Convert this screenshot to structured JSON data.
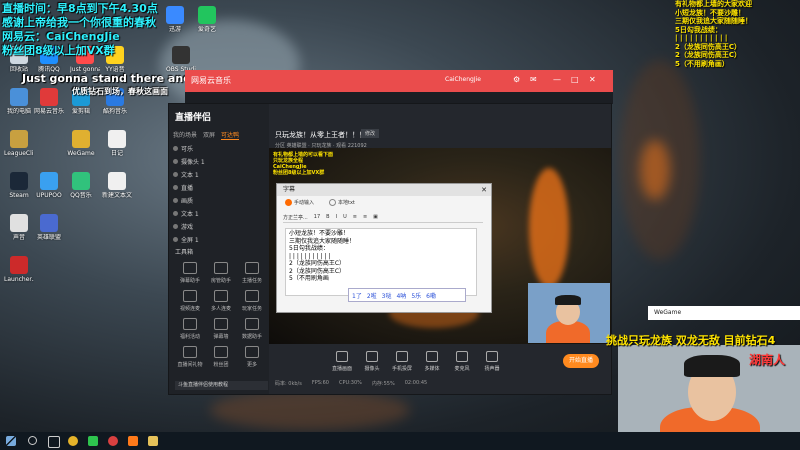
{
  "overlay_top": {
    "line1": "直播时间：早8点到下午4.30点",
    "line2": "感谢上帝给我一个你很重的春秋",
    "line3": "网易云：CaiChengJie",
    "line4": "粉丝团8级以上加VX群",
    "caption": "Just gonna stand there and hear me cry",
    "caption2": "优质钻石到场，春秋这画面"
  },
  "desktop_icons": [
    {
      "label": "回收站",
      "color": "#cfd8e0"
    },
    {
      "label": "腾讯QQ",
      "color": "#1e8fff"
    },
    {
      "label": "Just gonna",
      "color": "#ff4a4a"
    },
    {
      "label": "YY语音",
      "color": "#ffd21e"
    },
    {
      "label": "迅游",
      "color": "#3a8aff"
    },
    {
      "label": "爱奇艺",
      "color": "#22c55e"
    },
    {
      "label": "我的电脑",
      "color": "#4a90d9"
    },
    {
      "label": "网易云音乐",
      "color": "#e03a3a"
    },
    {
      "label": "爱剪辑",
      "color": "#1c9ad6"
    },
    {
      "label": "酷狗音乐",
      "color": "#2a7ae2"
    },
    {
      "label": "LeagueCli...",
      "color": "#c8a040"
    },
    {
      "label": "WeGame",
      "color": "#e0b030"
    },
    {
      "label": "日记",
      "color": "#f0f0f0"
    },
    {
      "label": "Steam",
      "color": "#1b2838"
    },
    {
      "label": "UPUPOO",
      "color": "#3aa0f0"
    },
    {
      "label": "QQ音乐",
      "color": "#31c27c"
    },
    {
      "label": "新建文本文档",
      "color": "#f0f0f0"
    },
    {
      "label": "声音",
      "color": "#e0e0e0"
    },
    {
      "label": "英雄联盟",
      "color": "#4a6ad0"
    },
    {
      "label": "Launcher...",
      "color": "#cc2a2a"
    },
    {
      "label": "OBS Studio",
      "color": "#333333"
    }
  ],
  "music_player": {
    "title": "网易云音乐",
    "user": "CaiChengJie",
    "controls": [
      "⚙",
      "✉",
      "—",
      "□",
      "✕"
    ]
  },
  "app": {
    "logo": "直播伴侣",
    "tabs": [
      "我的场景",
      "双屏",
      "可达鸭"
    ],
    "scenes": [
      "可乐",
      "摄像头 1",
      "文本 1",
      "直播",
      "画质",
      "文本 1",
      "游戏",
      "全屏 1"
    ],
    "tools_title": "工具箱",
    "tools": [
      {
        "label": "弹幕助手"
      },
      {
        "label": "房管助手"
      },
      {
        "label": "主播任务"
      },
      {
        "label": "视频连麦"
      },
      {
        "label": "多人连麦"
      },
      {
        "label": "玩家任务"
      },
      {
        "label": "福利活动"
      },
      {
        "label": "弹幕墙"
      },
      {
        "label": "数据助手"
      },
      {
        "label": "直播间礼物"
      },
      {
        "label": "粉丝团"
      },
      {
        "label": "更多"
      }
    ],
    "banner": "斗鱼直播伴侣使用教程",
    "room_title": "只玩龙族！从零上王者！！！",
    "room_button": "修改",
    "room_meta": "分区  英雄联盟 · 只玩龙族 · 观看  221092",
    "bottom_toolbar": [
      "直播画面",
      "摄像头",
      "手机投屏",
      "多媒体",
      "麦克风",
      "扬声器"
    ],
    "live_button": "开始直播",
    "status": [
      "码率: 0kb/s",
      "FPS:60",
      "CPU:30%",
      "内存:55%",
      "02:00:45"
    ]
  },
  "stage_overlay": {
    "lines": [
      "有礼物都上墙的可以看下面",
      "只玩龙族全程",
      "CaiChengJie",
      "粉丝团8级以上加VX群"
    ]
  },
  "dialog": {
    "title": "字幕",
    "radio_manual": "手动输入",
    "radio_auto": "本地txt",
    "font_select": "方正兰亭...",
    "font_size": "17",
    "toolbar_icons": [
      "B",
      "I",
      "U",
      "≡",
      "≡",
      "▣"
    ],
    "lines": [
      "小短龙族！不要沙雕！",
      "三期仅我追大家随随睡！",
      "5日勾我战绩：",
      "| | | | | | | | | | |",
      "2（龙族同伤高王C）",
      "2（龙族同伤高王C）",
      "5（不用刷角画"
    ]
  },
  "ime_candidates": [
    "1了",
    "2啦",
    "3哒",
    "4呐",
    "5乐",
    "6嘞"
  ],
  "side_overlay_lines": [
    "有礼物都上墙的大家欢迎",
    "小短龙族！不要沙雕！",
    "三期仅我追大家随随睡！",
    "5日勾我战绩：",
    "| | | | | | | | | | |",
    "2（龙族同伤高王C）",
    "2（龙族同伤高王C）",
    "5（不用刷角画）"
  ],
  "wegame_label": "WeGame",
  "scroll_text": "挑战只玩龙族 双龙无敌  目前钻石4",
  "hunan_label": "湖南人",
  "taskbar": {
    "icons": [
      "start",
      "search",
      "taskview",
      "chrome",
      "wechat",
      "netease",
      "douyu",
      "folder"
    ]
  }
}
